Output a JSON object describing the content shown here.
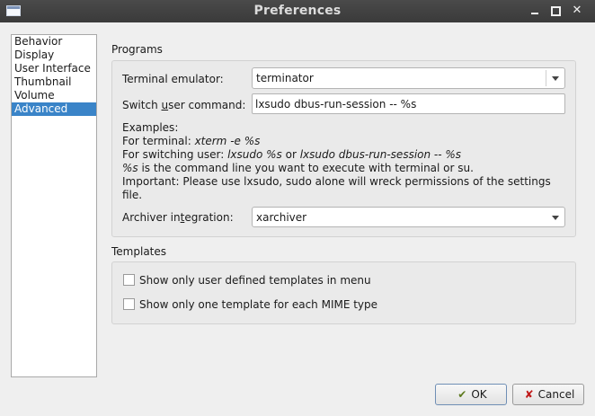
{
  "window": {
    "title": "Preferences"
  },
  "sidebar": {
    "items": [
      {
        "label": "Behavior"
      },
      {
        "label": "Display"
      },
      {
        "label": "User Interface"
      },
      {
        "label": "Thumbnail"
      },
      {
        "label": "Volume"
      },
      {
        "label": "Advanced",
        "selected": true
      }
    ]
  },
  "programs": {
    "heading": "Programs",
    "terminal_label": "Terminal emulator:",
    "terminal_value": "terminator",
    "switch_label_pre": "Switch ",
    "switch_label_ul": "u",
    "switch_label_post": "ser command:",
    "switch_value": "lxsudo dbus-run-session -- %s",
    "examples_title": "Examples:",
    "ex_terminal_prefix": "For terminal: ",
    "ex_terminal_cmd": "xterm -e %s",
    "ex_switch_prefix": "For switching user: ",
    "ex_switch_cmd1": "lxsudo %s",
    "ex_switch_or": " or ",
    "ex_switch_cmd2": "lxsudo dbus-run-session -- %s",
    "ex_placeholder": "%s",
    "ex_placeholder_desc": " is the command line you want to execute with terminal or su.",
    "important": "Important: Please use lxsudo, sudo alone will wreck permissions of the settings file.",
    "archiver_label_pre": "Archiver in",
    "archiver_label_ul": "t",
    "archiver_label_post": "egration:",
    "archiver_value": "xarchiver"
  },
  "templates": {
    "heading": "Templates",
    "opt1": {
      "label": "Show only user defined templates in menu",
      "checked": false
    },
    "opt2": {
      "label": "Show only one template for each MIME type",
      "checked": false
    }
  },
  "buttons": {
    "ok": "OK",
    "cancel": "Cancel"
  },
  "icons": {
    "window": "window-icon",
    "ok": "ok-check-icon",
    "cancel": "cancel-x-icon"
  }
}
